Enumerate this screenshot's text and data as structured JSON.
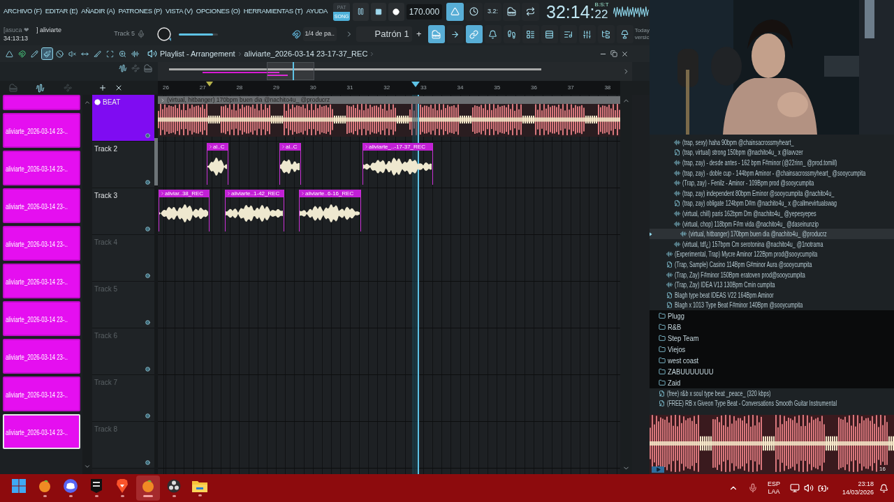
{
  "menu": [
    "ARCHIVO (F)",
    "EDITAR (E)",
    "AÑADIR (A)",
    "PATRONES (P)",
    "VISTA (V)",
    "OPCIONES (O)",
    "HERRAMIENTAS (T)",
    "AYUDA"
  ],
  "transport": {
    "modes": [
      {
        "label": "PAT",
        "selected": false
      },
      {
        "label": "SONG",
        "selected": true
      }
    ],
    "playing": true,
    "tempo": "170.000"
  },
  "toggles": [
    {
      "on": true
    },
    {
      "on": false
    },
    {
      "label": "3.2:",
      "on": false
    },
    {
      "on": false
    },
    {
      "on": false
    }
  ],
  "time": {
    "value": "32:14:",
    "sub": "22",
    "unit": "B:S:T"
  },
  "hint": {
    "user": "[asuca ❤",
    "project": "] aliviarte",
    "elapsed": "34:13:13"
  },
  "target": "Track 5",
  "volume": {
    "level": 0.88
  },
  "snap": "1/4 de pa..",
  "pattern": "Patrón 1",
  "pattern_add": "+",
  "tool_buttons": [
    {
      "on": true
    },
    {
      "on": false
    },
    {
      "on": true
    },
    {
      "on": false
    },
    {
      "on": false
    },
    {
      "on": false
    },
    {
      "on": false
    },
    {
      "on": false
    },
    {
      "on": false
    },
    {
      "on": false
    },
    {
      "on": false
    }
  ],
  "news": [
    "Today",
    "versic"
  ],
  "playlist": {
    "title": "Playlist - Arrangement",
    "clip_name": "aliviarte_2026-03-14 23-17-37_REC",
    "tools": [
      {
        "selected": false
      },
      {
        "selected": false
      },
      {
        "selected": false
      },
      {
        "selected": true
      },
      {
        "selected": false
      },
      {
        "selected": false
      },
      {
        "selected": false
      },
      {
        "selected": false
      },
      {
        "selected": false
      },
      {
        "selected": false
      },
      {
        "selected": false
      }
    ],
    "ruler": [
      "26",
      "27",
      "28",
      "29",
      "30",
      "31",
      "32",
      "33",
      "34",
      "35",
      "36",
      "37",
      "38"
    ],
    "picker": [
      {
        "selected": false
      },
      {
        "label": "aliviarte_2026-03-14 23-..",
        "selected": false
      },
      {
        "label": "aliviarte_2026-03-14 23-..",
        "selected": false
      },
      {
        "label": "aliviarte_2026-03-14 23-..",
        "selected": false
      },
      {
        "label": "aliviarte_2026-03-14 23-..",
        "selected": false
      },
      {
        "label": "aliviarte_2026-03-14 23-..",
        "selected": false
      },
      {
        "label": "aliviarte_2026-03-14 23-..",
        "selected": false
      },
      {
        "label": "aliviarte_2026-03-14 23-..",
        "selected": false
      },
      {
        "label": "aliviarte_2026-03-14 23-..",
        "selected": false
      },
      {
        "label": "aliviarte_2026-03-14 23-..",
        "selected": true
      }
    ],
    "tracks": [
      {
        "name": "BEAT",
        "selected": true,
        "clips": [
          {
            "kind": "beat",
            "label": "(virtual, hitbanger) 170bpm buen dia @nachito4u_ @producrz"
          }
        ]
      },
      {
        "name": "Track 2",
        "selected": false,
        "clips": [
          {
            "kind": "audio",
            "label": "al..C"
          },
          {
            "kind": "audio",
            "label": "al..C"
          },
          {
            "kind": "audio",
            "label": "aliviarte_..-17-37_REC"
          }
        ]
      },
      {
        "name": "Track 3",
        "selected": false,
        "clips": [
          {
            "kind": "audio",
            "label": "aliviar..38_REC"
          },
          {
            "kind": "audio",
            "label": "aliviarte..1-42_REC"
          },
          {
            "kind": "audio",
            "label": "aliviarte..6-16_REC"
          }
        ]
      },
      {
        "name": "Track 4",
        "selected": false
      },
      {
        "name": "Track 5",
        "selected": false
      },
      {
        "name": "Track 6",
        "selected": false
      },
      {
        "name": "Track 7",
        "selected": false
      },
      {
        "name": "Track 8",
        "selected": false
      }
    ]
  },
  "browser": {
    "items": [
      {
        "kind": "group",
        "children": [
          {
            "kind": "group",
            "children": [
              {
                "kind": "audio",
                "label": "(trap, sexy) haha 90bpm @chainsacrossmyheart_",
                "selected": false
              },
              {
                "kind": "mp3",
                "label": "(trap, virtual) strong 150bpm @nachito4u_ x @lavvzer",
                "selected": false
              },
              {
                "kind": "audio",
                "label": "(trap, zay) - desde antes - 162 bpm F#minor (@22rinn_ @prod.tomill)",
                "selected": false
              },
              {
                "kind": "audio",
                "label": "(trap, zay) - doble cup - 144bpm Aminor - @chainsacrossmyheart_ @sooycumpita",
                "selected": false
              },
              {
                "kind": "audio",
                "label": "(Trap, zay) - Fenilz - Aminor - 109Bpm prod @sooycumpita",
                "selected": false
              },
              {
                "kind": "audio",
                "label": "(trap, zay) independent 80bpm Eminor @sooycumpita @nachito4u_",
                "selected": false
              },
              {
                "kind": "mp3",
                "label": "(trap, zay) obligate 124bpm D#m @nachito4u_ x @callmevirtualswag",
                "selected": false
              },
              {
                "kind": "audio",
                "label": "(virtual, chill) paris 162bpm Dm @nachito4u_ @yepesyepes",
                "selected": false
              },
              {
                "kind": "audio",
                "label": "(virtual, chop) 118bpm F#m vida @nachito4u_ @daseinunzip",
                "selected": false
              },
              {
                "kind": "audio",
                "label": "(virtual, hitbanger) 170bpm buen dia @nachito4u_ @producrz",
                "selected": true
              },
              {
                "kind": "audio",
                "label": "(virtual, tdf¿) 157bpm Cm serotonina @nachito4u_ @1notrama",
                "selected": false
              }
            ]
          },
          {
            "kind": "audio",
            "label": "(Experimental, Trap) Mycre Aminor 122Bpm prod@sooycumpita",
            "selected": false
          },
          {
            "kind": "mp3",
            "label": "(Trap, Sample) Casino 114Bpm G#minor Aura @sooycumpita",
            "selected": false
          },
          {
            "kind": "audio",
            "label": "(Trap, Zay) F#minor 150Bpm eratoven prod@sooycumpita",
            "selected": false
          },
          {
            "kind": "audio",
            "label": "(Trap, Zay) IDEA V13 130Bpm Cmin cumpita",
            "selected": false
          },
          {
            "kind": "mp3",
            "label": "Blagh type beat IDEAS V22 164Bpm Aminor",
            "selected": false
          },
          {
            "kind": "mp3",
            "label": "Blagh x 1013 Type Beat F#minor 140Bpm @sooycumpita",
            "selected": false
          }
        ]
      },
      {
        "kind": "folder",
        "label": "Plugg",
        "selected": false
      },
      {
        "kind": "folder",
        "label": "R&B",
        "selected": false
      },
      {
        "kind": "folder",
        "label": "Step Team",
        "selected": false
      },
      {
        "kind": "folder",
        "label": "Viejos",
        "selected": false
      },
      {
        "kind": "folder",
        "label": "west coast",
        "selected": false
      },
      {
        "kind": "folder",
        "label": "ZABUUUUUUU",
        "selected": false
      },
      {
        "kind": "folder",
        "label": "Zaid",
        "selected": false
      },
      {
        "kind": "mp3",
        "label": "(free) r&b x soul type beat _peace_ (320 kbps)",
        "selected": false
      },
      {
        "kind": "mp3",
        "label": "(FREE) RB x Giveon Type Beat - Conversations  Smooth Guitar Instrumental",
        "selected": false
      }
    ],
    "preview_label": "16"
  },
  "taskbar": {
    "apps": [
      {
        "kind": "start",
        "running": false,
        "active": false
      },
      {
        "kind": "fruit",
        "running": true,
        "active": false
      },
      {
        "kind": "chat",
        "running": true,
        "active": false
      },
      {
        "kind": "store",
        "running": true,
        "active": false
      },
      {
        "kind": "browser",
        "running": true,
        "active": false
      },
      {
        "kind": "fruit",
        "running": true,
        "active": true
      },
      {
        "kind": "recorder",
        "running": true,
        "active": false
      },
      {
        "kind": "files",
        "running": true,
        "active": false
      }
    ],
    "lang": [
      "ESP",
      "LAA"
    ],
    "time": "23:18",
    "date": "14/03/2026"
  }
}
